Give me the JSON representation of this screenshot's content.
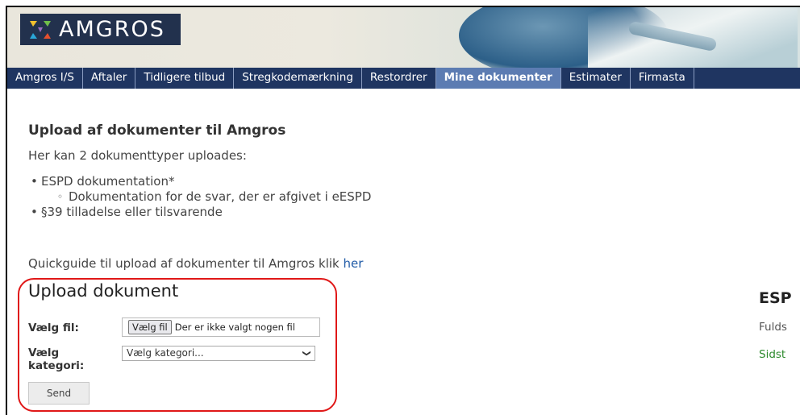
{
  "brand": {
    "logo_text": "AMGROS"
  },
  "nav": {
    "items": [
      {
        "label": "Amgros I/S"
      },
      {
        "label": "Aftaler"
      },
      {
        "label": "Tidligere tilbud"
      },
      {
        "label": "Stregkodemærkning"
      },
      {
        "label": "Restordrer"
      },
      {
        "label": "Mine dokumenter",
        "active": true
      },
      {
        "label": "Estimater"
      },
      {
        "label": "Firmasta"
      }
    ]
  },
  "main": {
    "title": "Upload af dokumenter til Amgros",
    "intro": "Her kan 2 dokumenttyper uploades:",
    "bullets": {
      "espd": "ESPD dokumentation*",
      "espd_sub": "Dokumentation for de svar, der er afgivet i eESPD",
      "permit": "§39 tilladelse eller tilsvarende"
    },
    "quickguide_text": "Quickguide til upload af dokumenter til Amgros klik ",
    "quickguide_link": "her"
  },
  "upload": {
    "title": "Upload dokument",
    "file_label": "Vælg fil:",
    "file_button": "Vælg fil",
    "file_status": "Der er ikke valgt nogen fil",
    "category_label_1": "Vælg",
    "category_label_2": "kategori:",
    "category_selected": "Vælg kategori...",
    "send_label": "Send"
  },
  "side": {
    "title": "ESP",
    "line1": "Fulds",
    "line2": "Sidst"
  },
  "colors": {
    "nav_bg": "#1f3561",
    "nav_active": "#5c7cb2",
    "logo_bg": "#22314d",
    "link": "#1f5aa6",
    "highlight": "#e01818",
    "status_green": "#2d8a2d"
  }
}
